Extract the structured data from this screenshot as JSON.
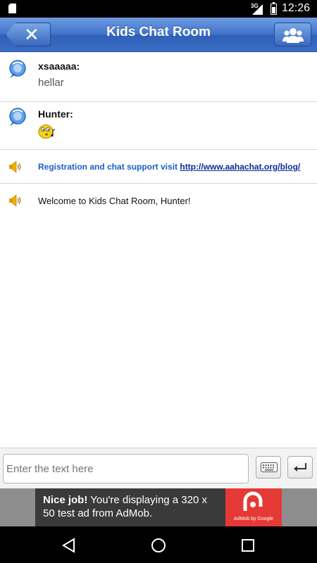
{
  "status_bar": {
    "network": "3G",
    "time": "12:26"
  },
  "header": {
    "title": "Kids Chat Room"
  },
  "messages": [
    {
      "user": "xsaaaaa:",
      "text": "hellar"
    },
    {
      "user": "Hunter:",
      "text": ""
    }
  ],
  "system_messages": [
    {
      "text": "Registration and chat support visit ",
      "link": "http://www.aahachat.org/blog/"
    },
    {
      "text": "Welcome to Kids Chat Room, Hunter!"
    }
  ],
  "input": {
    "placeholder": "Enter the text here",
    "value": ""
  },
  "ad": {
    "headline": "Nice job!",
    "body": " You're displaying a 320 x 50 test ad from AdMob.",
    "brand": "AdMob by Google"
  },
  "colors": {
    "header_blue": "#3f73cb",
    "system_blue": "#1a5ec8",
    "ad_red": "#e53935"
  }
}
